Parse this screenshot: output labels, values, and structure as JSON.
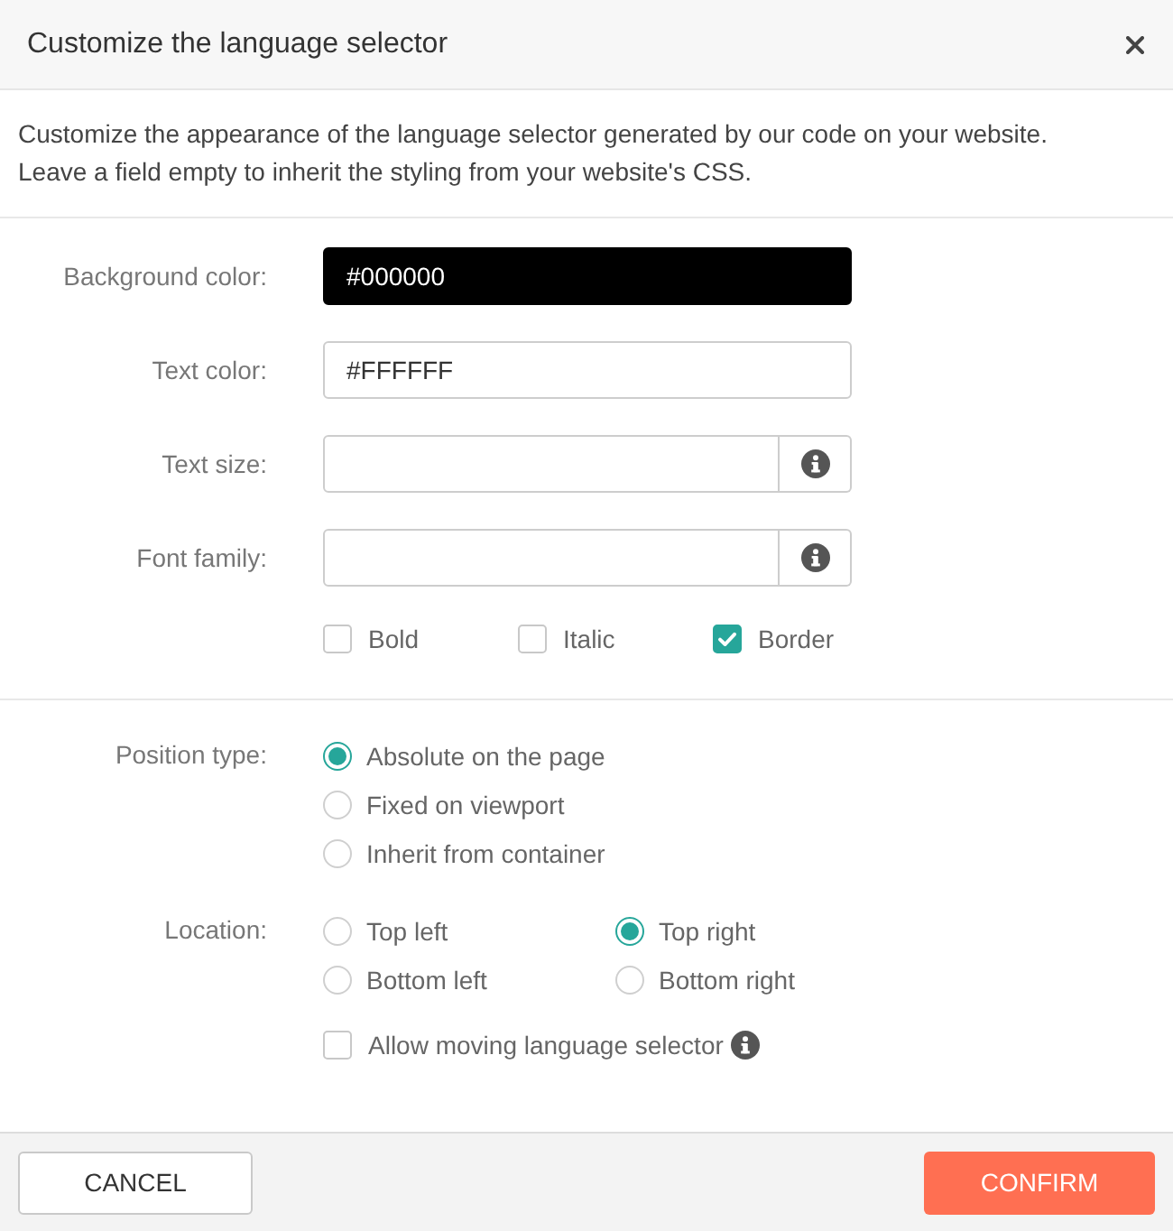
{
  "dialog": {
    "title": "Customize the language selector"
  },
  "description": [
    "Customize the appearance of the language selector generated by our code on your website.",
    "Leave a field empty to inherit the styling from your website's CSS."
  ],
  "fields": [
    {
      "label": "Background color:",
      "value": "#000000",
      "kind": "plain",
      "color": "#000000"
    },
    {
      "label": "Text color:",
      "value": "#FFFFFF",
      "kind": "plain"
    },
    {
      "label": "Text size:",
      "kind": "info"
    },
    {
      "label": "Font family:",
      "kind": "info"
    }
  ],
  "font_styles": [
    {
      "label": "Bold",
      "checked": false
    },
    {
      "label": "Italic",
      "checked": false
    },
    {
      "label": "Border",
      "checked": true
    }
  ],
  "position_type": {
    "label": "Position type:",
    "options": [
      {
        "label": "Absolute on the page",
        "selected": true
      },
      {
        "label": "Fixed on viewport",
        "selected": false
      },
      {
        "label": "Inherit from container",
        "selected": false
      }
    ]
  },
  "location": {
    "label": "Location:",
    "options": [
      {
        "label": "Top left",
        "selected": false
      },
      {
        "label": "Top right",
        "selected": true
      },
      {
        "label": "Bottom left",
        "selected": false
      },
      {
        "label": "Bottom right",
        "selected": false
      }
    ]
  },
  "allow_moving": {
    "label": "Allow moving language selector",
    "checked": false
  },
  "buttons": [
    {
      "label": "CANCEL",
      "kind": "secondary"
    },
    {
      "label": "CONFIRM",
      "kind": "primary"
    }
  ]
}
